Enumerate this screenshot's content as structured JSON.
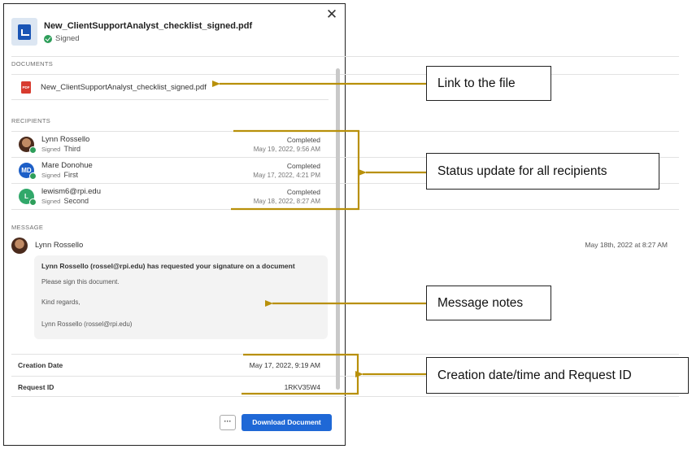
{
  "colors": {
    "accent": "#1f68d6",
    "signed_green": "#2e9e5a",
    "annotation_gold": "#b8900a",
    "pdf_red": "#d83b2f"
  },
  "header": {
    "filename": "New_ClientSupportAnalyst_checklist_signed.pdf",
    "status": "Signed",
    "file_icon": "document-file-icon",
    "close_icon": "close-icon",
    "close_glyph": "✕"
  },
  "documents": {
    "heading": "DOCUMENTS",
    "items": [
      {
        "name": "New_ClientSupportAnalyst_checklist_signed.pdf",
        "icon": "pdf-icon",
        "icon_text": "PDF"
      }
    ]
  },
  "recipients": {
    "heading": "RECIPIENTS",
    "items": [
      {
        "name": "Lynn Rossello",
        "signed_label": "Signed",
        "order": "Third",
        "status": "Completed",
        "date": "May 19, 2022, 9:56 AM",
        "avatar": "photo"
      },
      {
        "name": "Mare Donohue",
        "signed_label": "Signed",
        "order": "First",
        "status": "Completed",
        "date": "May 17, 2022, 4:21 PM",
        "avatar_initials": "MD"
      },
      {
        "name": "lewism6@rpi.edu",
        "signed_label": "Signed",
        "order": "Second",
        "status": "Completed",
        "date": "May 18, 2022, 8:27 AM",
        "avatar_initials": "L"
      }
    ]
  },
  "message": {
    "heading": "MESSAGE",
    "sender": "Lynn Rossello",
    "time": "May 18th, 2022 at 8:27 AM",
    "subject": "Lynn Rossello (rossel@rpi.edu) has requested your signature on a document",
    "body": "Please sign this document.",
    "closing": "Kind regards,",
    "signature": "Lynn Rossello (rossel@rpi.edu)"
  },
  "meta": {
    "creation_date_label": "Creation Date",
    "creation_date_value": "May 17, 2022, 9:19 AM",
    "request_id_label": "Request ID",
    "request_id_value": "1RKV35W4"
  },
  "footer": {
    "more_label": "···",
    "download_label": "Download Document"
  },
  "annotations": [
    "Link to the file",
    "Status update for all recipients",
    "Message notes",
    "Creation date/time and Request ID"
  ]
}
